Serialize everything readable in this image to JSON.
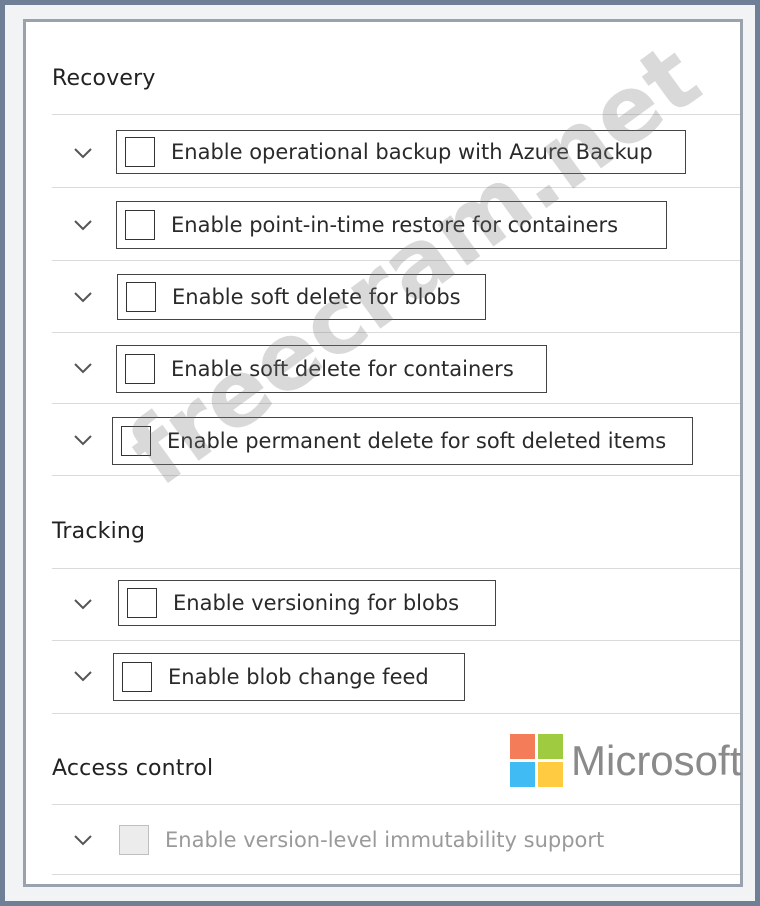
{
  "sections": [
    {
      "title": "Recovery",
      "items": [
        {
          "label": "Enable operational backup with Azure Backup",
          "checked": false
        },
        {
          "label": "Enable point-in-time restore for containers",
          "checked": false
        },
        {
          "label": "Enable soft delete for blobs",
          "checked": false
        },
        {
          "label": "Enable soft delete for containers",
          "checked": false
        },
        {
          "label": "Enable permanent delete for soft deleted items",
          "checked": false
        }
      ]
    },
    {
      "title": "Tracking",
      "items": [
        {
          "label": "Enable versioning for blobs",
          "checked": false
        },
        {
          "label": "Enable blob change feed",
          "checked": false
        }
      ]
    },
    {
      "title": "Access control",
      "items": [
        {
          "label": "Enable version-level immutability support",
          "checked": false,
          "disabled": true
        }
      ]
    }
  ],
  "watermark": "freecram.net",
  "logo": {
    "text": "Microsoft",
    "colors": [
      "#f25022",
      "#7fba00",
      "#00a4ef",
      "#ffb900"
    ]
  }
}
